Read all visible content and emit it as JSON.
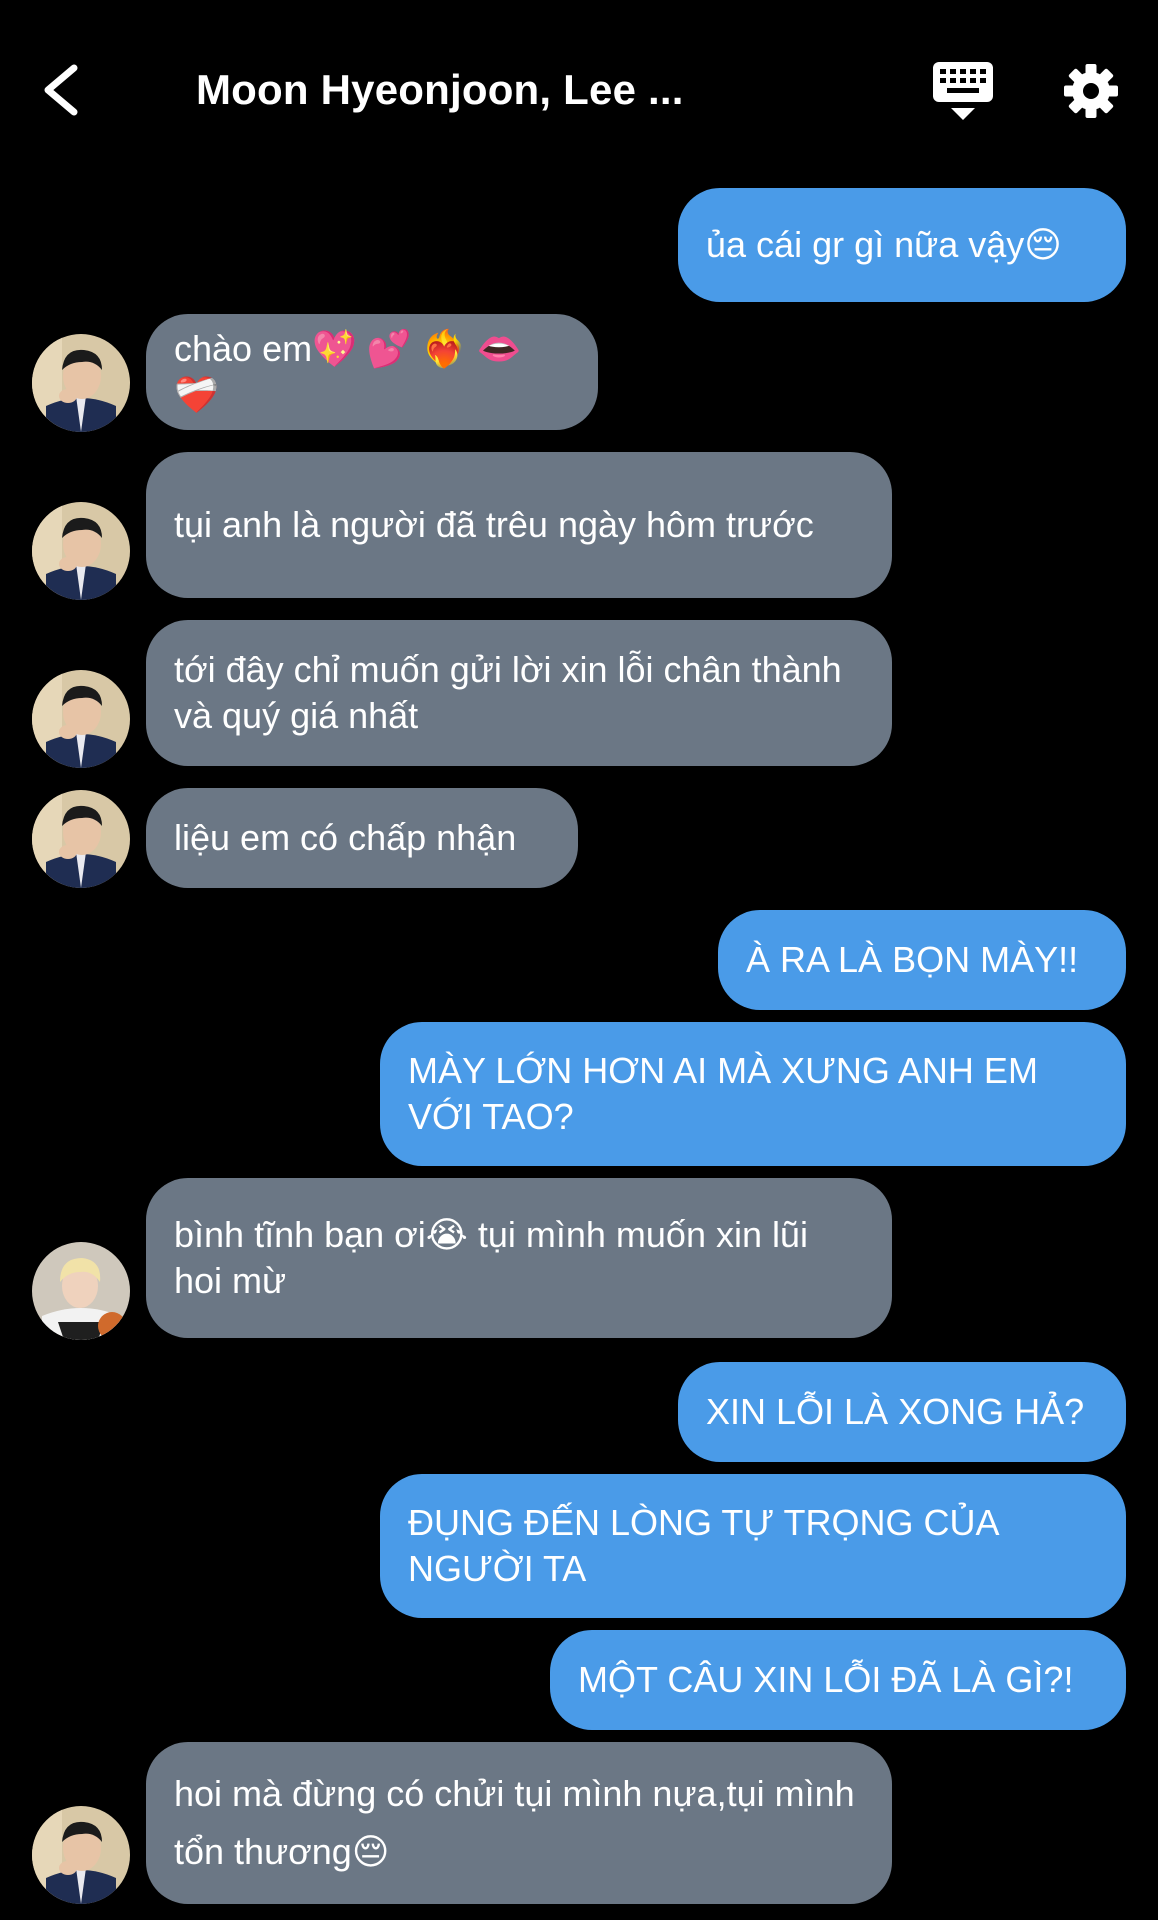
{
  "header": {
    "title": "Moon Hyeonjoon, Lee ...",
    "back_icon": "chevron-left-icon",
    "keyboard_icon": "keyboard-icon",
    "settings_icon": "gear-icon"
  },
  "colors": {
    "background": "#000000",
    "sent_bubble": "#4a9be8",
    "received_bubble": "#6b7785",
    "text": "#ffffff"
  },
  "messages": [
    {
      "from": "me",
      "text": "ủa cái gr gì nữa vậy😔"
    },
    {
      "from": "contact-1",
      "text": "chào em💖 💕 ❤️‍🔥 👄 ❤️‍🩹"
    },
    {
      "from": "contact-1",
      "text": "tụi anh là người đã trêu ngày hôm trước"
    },
    {
      "from": "contact-1",
      "text": "tới đây chỉ muốn gửi lời xin lỗi chân thành và quý giá nhất"
    },
    {
      "from": "contact-1",
      "text": "liệu em có chấp nhận"
    },
    {
      "from": "me",
      "text": "À RA LÀ BỌN MÀY!!"
    },
    {
      "from": "me",
      "text": "MÀY LỚN HƠN AI MÀ XƯNG ANH EM VỚI TAO?"
    },
    {
      "from": "contact-2",
      "text": "bình tĩnh bạn ơi😭  tụi mình muốn xin lũi hoi mừ"
    },
    {
      "from": "me",
      "text": "XIN LỖI LÀ XONG HẢ?"
    },
    {
      "from": "me",
      "text": "ĐỤNG ĐẾN LÒNG TỰ TRỌNG CỦA NGƯỜI TA"
    },
    {
      "from": "me",
      "text": "MỘT CÂU XIN LỖI ĐÃ LÀ GÌ?!"
    },
    {
      "from": "contact-1",
      "text": "hoi mà đừng có chửi tụi mình nựa,tụi mình tổn thương😔"
    }
  ]
}
